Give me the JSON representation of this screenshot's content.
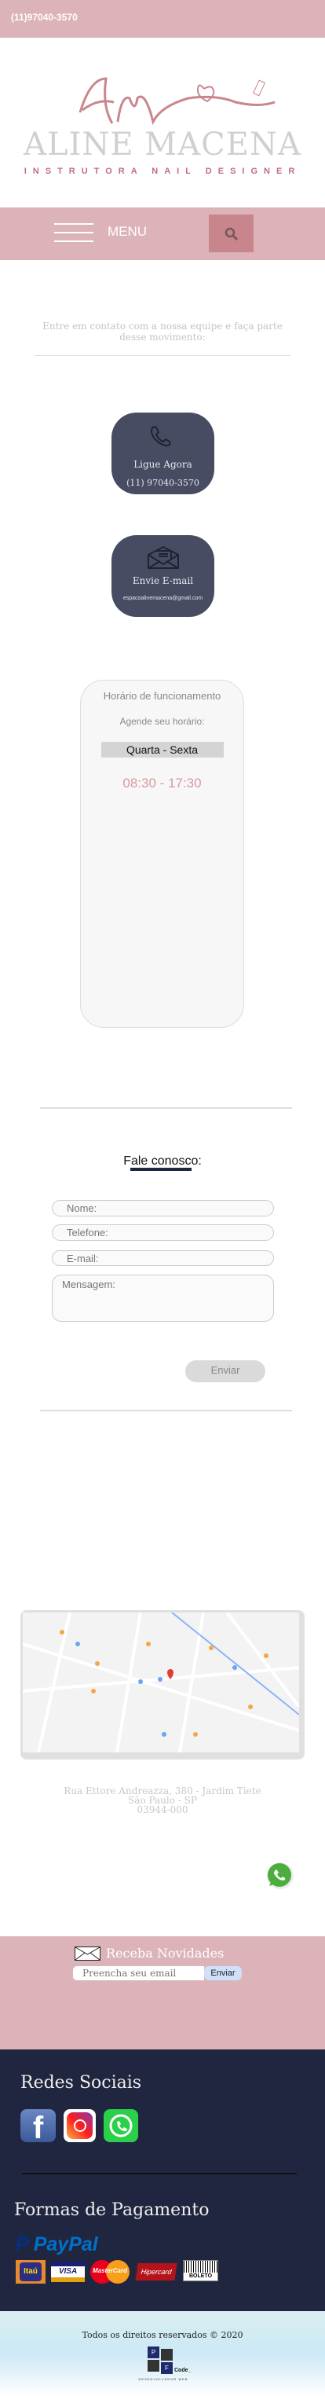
{
  "topbar": {
    "phone": "(11)97040-3570"
  },
  "logo": {
    "monogram": "Am",
    "name": "ALINE MACENA",
    "tagline": "INSTRUTORA NAIL DESIGNER"
  },
  "nav": {
    "menu_label": "MENU",
    "search_icon": "search-icon",
    "menu_icon": "hamburger-icon"
  },
  "intro": {
    "text": "Entre em contato com a nossa equipe e faça parte desse movimento:"
  },
  "contact_cards": [
    {
      "icon": "phone-icon",
      "title": "Ligue Agora",
      "value": "(11) 97040-3570"
    },
    {
      "icon": "envelope-open-icon",
      "title": "Envie E-mail",
      "value": "espacoalinemacena@gmail.com"
    }
  ],
  "hours": {
    "title": "Horário de funcionamento",
    "subtitle": "Agende seu horário:",
    "days": "Quarta - Sexta",
    "time": "08:30 - 17:30"
  },
  "form": {
    "title": "Fale conosco:",
    "name_placeholder": "Nome:",
    "phone_placeholder": "Telefone:",
    "email_placeholder": "E-mail:",
    "message_placeholder": "Mensagem:",
    "submit": "Enviar"
  },
  "address": {
    "line1": "Rua Ettore Andreazza, 380 - Jardim Tiete",
    "line2": "São Paulo - SP",
    "line3": "03944-000"
  },
  "newsletter": {
    "title": "Receba Novidades",
    "placeholder": "Preencha seu email",
    "submit": "Enviar"
  },
  "footer": {
    "social_title": "Redes Sociais",
    "social": [
      "facebook",
      "instagram",
      "whatsapp"
    ],
    "payment_title": "Formas de Pagamento",
    "payments": [
      "PayPal",
      "Itaú",
      "VISA",
      "MasterCard",
      "Hipercard",
      "BOLETO"
    ],
    "copyright": "Todos os direitos reservados © 2020",
    "dev_logo": "Code_",
    "dev_tagline": "DESENVOLVEDOR WEB"
  },
  "colors": {
    "pink": "#dcb3b8",
    "accent": "#c8868c",
    "card": "#474c62",
    "footer": "#20263f"
  }
}
